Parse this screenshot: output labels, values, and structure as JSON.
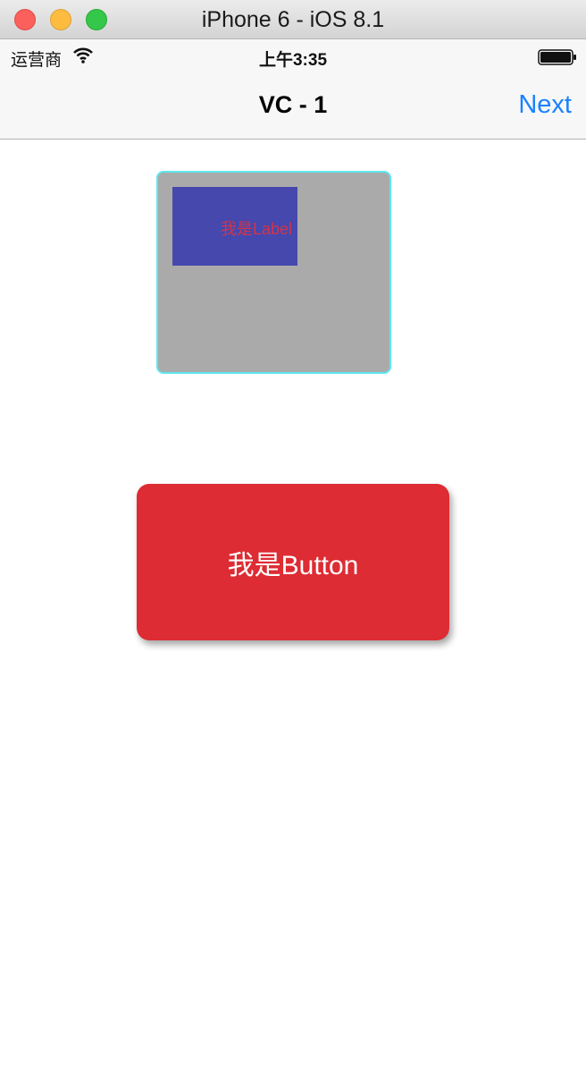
{
  "window": {
    "title": "iPhone 6 - iOS 8.1",
    "controls": [
      "close",
      "minimize",
      "zoom"
    ]
  },
  "status_bar": {
    "carrier": "运营商",
    "time": "上午3:35",
    "icons": [
      "wifi-icon",
      "battery-icon"
    ]
  },
  "nav_bar": {
    "title": "VC - 1",
    "right_button": "Next"
  },
  "content": {
    "label_text": "我是Label",
    "button_label": "我是Button"
  },
  "colors": {
    "nav_tint": "#1a82fb",
    "button_red": "#dd2c33",
    "label_red": "#d0354a",
    "blue_view": "#4648ae",
    "gray_view": "#aaaaaa",
    "cyan_border": "#5fe6ee"
  }
}
